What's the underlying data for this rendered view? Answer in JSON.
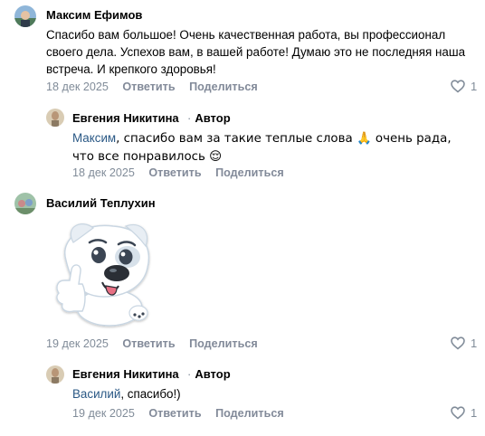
{
  "comments": [
    {
      "author": "Максим Ефимов",
      "text": "Спасибо вам большое! Очень качественная работа, вы профессионал своего дела. Успехов вам, в вашей работе! Думаю это не последняя наша встреча. И крепкого здоровья!",
      "date": "18 дек 2025",
      "reply_label": "Ответить",
      "share_label": "Поделиться",
      "likes": "1",
      "reply": {
        "author": "Евгения Никитина",
        "author_badge": "Автор",
        "mention": "Максим",
        "text": ", спасибо вам за такие теплые слова 🙏 очень рада, что все понравилось 😌",
        "date": "18 дек 2025",
        "reply_label": "Ответить",
        "share_label": "Поделиться"
      }
    },
    {
      "author": "Василий Теплухин",
      "sticker": "dog-thumbs-up-sticker",
      "date": "19 дек 2025",
      "reply_label": "Ответить",
      "share_label": "Поделиться",
      "likes": "1",
      "reply": {
        "author": "Евгения Никитина",
        "author_badge": "Автор",
        "mention": "Василий",
        "text": ", спасибо!)",
        "date": "19 дек 2025",
        "reply_label": "Ответить",
        "share_label": "Поделиться",
        "likes": "1"
      }
    }
  ],
  "colors": {
    "link": "#2a5885",
    "meta": "#818c99"
  }
}
